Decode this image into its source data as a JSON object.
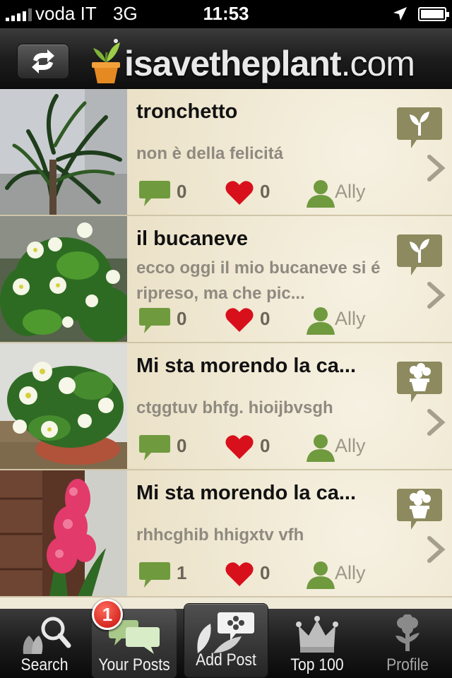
{
  "status_bar": {
    "carrier": "voda IT",
    "network": "3G",
    "time": "11:53"
  },
  "header": {
    "logo_text_bold": "isavetheplant",
    "logo_text_tail": ".com",
    "refresh_icon": "refresh-icon"
  },
  "posts": [
    {
      "title": "tronchetto",
      "description": "non è della felicitá",
      "comments": "0",
      "likes": "0",
      "user": "Ally",
      "category_icon": "sprout-icon"
    },
    {
      "title": "il bucaneve",
      "description": "ecco oggi il mio bucaneve si é ripreso, ma che pic...",
      "comments": "0",
      "likes": "0",
      "user": "Ally",
      "category_icon": "sprout-icon"
    },
    {
      "title": "Mi sta morendo la ca...",
      "description": "ctggtuv bhfg. hioijbvsgh",
      "comments": "0",
      "likes": "0",
      "user": "Ally",
      "category_icon": "potted-plant-icon"
    },
    {
      "title": "Mi sta morendo la ca...",
      "description": "rhhcghib hhigxtv vfh",
      "comments": "1",
      "likes": "0",
      "user": "Ally",
      "category_icon": "potted-plant-icon"
    }
  ],
  "tabbar": {
    "tabs": [
      {
        "label": "Search",
        "icon": "search-icon"
      },
      {
        "label": "Your Posts",
        "icon": "chat-bubbles-icon",
        "badge": "1"
      },
      {
        "label": "Add Post",
        "icon": "add-post-icon"
      },
      {
        "label": "Top 100",
        "icon": "crown-icon"
      },
      {
        "label": "Profile",
        "icon": "profile-plant-icon"
      }
    ]
  },
  "colors": {
    "accent_green": "#6f9a3e",
    "heart_red": "#d8101c",
    "badge_olive": "#8c8a5e",
    "list_background": "#efe9d8"
  }
}
